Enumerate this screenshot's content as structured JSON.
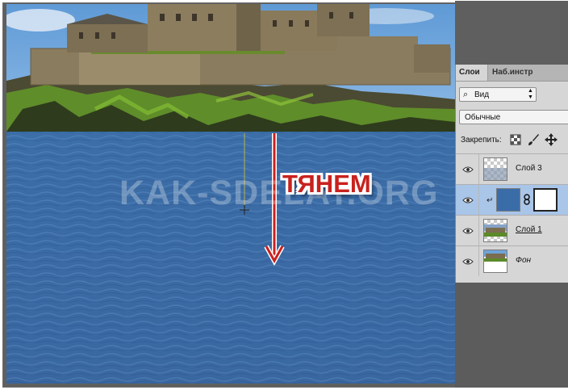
{
  "watermark": "KAK-SDELAT.ORG",
  "annotation": {
    "drag_label": "ТЯНЕМ",
    "arrow_color": "#c8221e"
  },
  "layers_panel": {
    "tabs": [
      {
        "label": "Слои",
        "active": true
      },
      {
        "label": "Наб.инстр",
        "active": false
      }
    ],
    "filter": {
      "icon": "search-icon",
      "value": "Вид"
    },
    "blend_mode": "Обычные",
    "lock_label": "Закрепить:",
    "lock_icons": [
      "lock-transparency-icon",
      "lock-brush-icon",
      "lock-move-icon"
    ],
    "layers": [
      {
        "name": "Слой 3",
        "visible": true,
        "selected": false,
        "thumb": "water-transparent"
      },
      {
        "name": "",
        "visible": true,
        "selected": true,
        "thumb": "solid-blue-with-mask",
        "clipped": true
      },
      {
        "name": "Слой 1",
        "visible": true,
        "selected": false,
        "thumb": "castle-transparent"
      },
      {
        "name": "Фон",
        "visible": true,
        "selected": false,
        "thumb": "castle-photo"
      }
    ]
  },
  "colors": {
    "water": "#3c6aa3",
    "sky": "#73a9dc",
    "selected_layer": "#a9c5e8",
    "fill_layer": "#3a6ca8"
  }
}
